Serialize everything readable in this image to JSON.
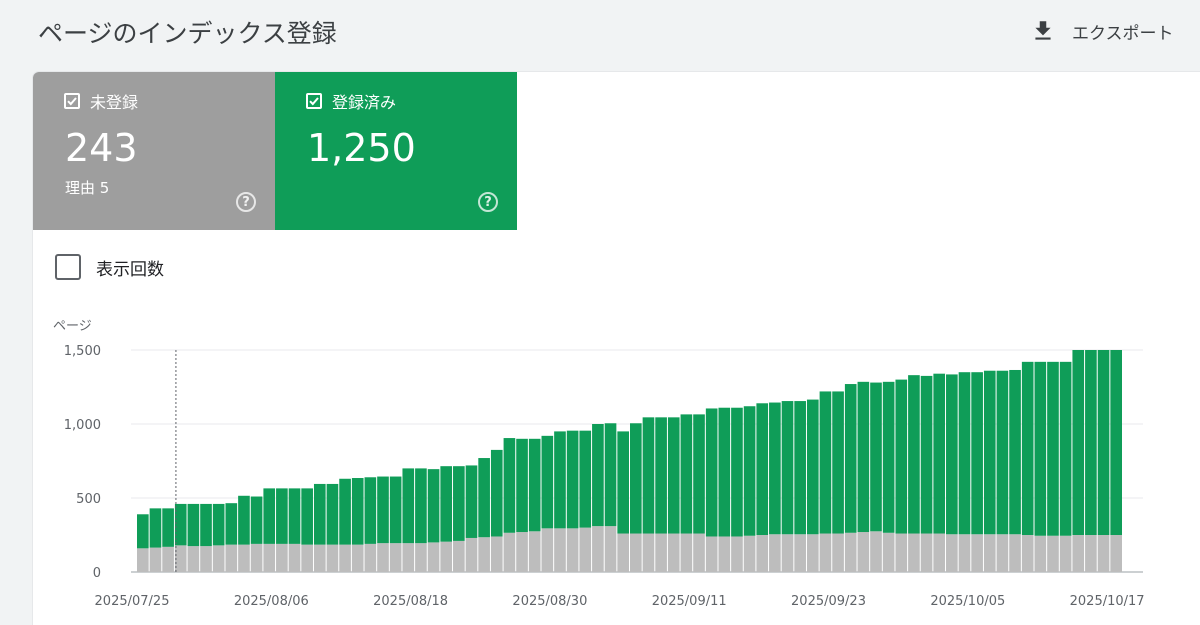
{
  "header": {
    "title": "ページのインデックス登録",
    "export_label": "エクスポート",
    "export_icon": "download-icon"
  },
  "summary": {
    "not_indexed": {
      "label": "未登録",
      "value": "243",
      "sub": "理由 5",
      "checked": true,
      "color": "#9e9e9e"
    },
    "indexed": {
      "label": "登録済み",
      "value": "1,250",
      "checked": true,
      "color": "#0f9d58"
    }
  },
  "impressions_toggle": {
    "label": "表示回数",
    "checked": false
  },
  "chart_data": {
    "type": "bar",
    "stacked": true,
    "ylabel": "ページ",
    "ylim": [
      0,
      1500
    ],
    "yticks": [
      "0",
      "500",
      "1,000",
      "1,500"
    ],
    "xtick_labels": [
      "2025/07/25",
      "2025/08/06",
      "2025/08/18",
      "2025/08/30",
      "2025/09/11",
      "2025/09/23",
      "2025/10/05",
      "2025/10/17"
    ],
    "hover_marker_index": 3,
    "series": [
      {
        "name": "未登録",
        "color": "#bdbdbd",
        "values": [
          160,
          165,
          170,
          180,
          175,
          175,
          180,
          185,
          185,
          190,
          190,
          190,
          190,
          185,
          185,
          185,
          185,
          185,
          190,
          195,
          195,
          195,
          195,
          200,
          205,
          210,
          230,
          235,
          240,
          265,
          270,
          275,
          295,
          295,
          295,
          300,
          310,
          310,
          260,
          260,
          260,
          260,
          260,
          260,
          260,
          240,
          240,
          240,
          245,
          250,
          255,
          255,
          255,
          255,
          260,
          260,
          265,
          270,
          275,
          265,
          260,
          260,
          260,
          260,
          255,
          255,
          255,
          255,
          255,
          255,
          250,
          245,
          245,
          245,
          250,
          250,
          250,
          250
        ]
      },
      {
        "name": "登録済み",
        "color": "#0f9d58",
        "values": [
          230,
          265,
          260,
          280,
          285,
          285,
          280,
          280,
          330,
          320,
          375,
          375,
          375,
          380,
          410,
          410,
          445,
          450,
          450,
          450,
          450,
          505,
          505,
          495,
          510,
          505,
          490,
          535,
          585,
          640,
          630,
          625,
          625,
          655,
          660,
          655,
          690,
          695,
          690,
          745,
          785,
          785,
          785,
          805,
          805,
          865,
          870,
          870,
          875,
          890,
          890,
          900,
          900,
          910,
          960,
          960,
          1005,
          1015,
          1005,
          1020,
          1040,
          1070,
          1065,
          1080,
          1080,
          1095,
          1095,
          1105,
          1105,
          1110,
          1170,
          1175,
          1175,
          1175,
          1250,
          1250,
          1250,
          1250
        ]
      }
    ]
  }
}
